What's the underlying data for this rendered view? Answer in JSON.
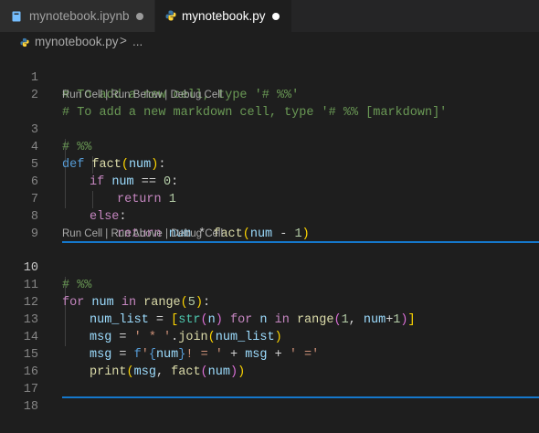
{
  "tabs": [
    {
      "title": "mynotebook.ipynb",
      "modified": true
    },
    {
      "title": "mynotebook.py",
      "modified": true
    }
  ],
  "breadcrumb": {
    "file": "mynotebook.py",
    "separator": ">",
    "more": "..."
  },
  "codelens": {
    "first": "Run Cell | Run Below | Debug Cell",
    "second": "Run Cell | Run Above | Debug Cell"
  },
  "line_numbers": [
    "1",
    "2",
    "3",
    "4",
    "5",
    "6",
    "7",
    "8",
    "9",
    "10",
    "11",
    "12",
    "13",
    "14",
    "15",
    "16",
    "17",
    "18"
  ],
  "active_line": "10",
  "code": {
    "l1": "# To add a new cell, type '# %%'",
    "l2": "# To add a new markdown cell, type '# %% [markdown]'",
    "l3": "# %%",
    "l4_kw": "def",
    "l4_fn": "fact",
    "l4_open": "(",
    "l4_param": "num",
    "l4_close": ")",
    "l4_colon": ":",
    "l5_kw": "if",
    "l5_var": "num",
    "l5_op": " == ",
    "l5_num": "0",
    "l5_colon": ":",
    "l6_kw": "return",
    "l6_num": "1",
    "l7_kw": "else",
    "l7_colon": ":",
    "l8_kw": "return",
    "l8_var": "num",
    "l8_op": " * ",
    "l8_fn": "fact",
    "l8_open": "(",
    "l8_var2": "num",
    "l8_op2": " - ",
    "l8_num": "1",
    "l8_close": ")",
    "l10": "# %%",
    "l11_kw": "for",
    "l11_var": "num",
    "l11_in": "in",
    "l11_fn": "range",
    "l11_open": "(",
    "l11_num": "5",
    "l11_close": ")",
    "l11_colon": ":",
    "l12_var": "num_list",
    "l12_eq": " = ",
    "l12_b1": "[",
    "l12_cls": "str",
    "l12_p1": "(",
    "l12_n": "n",
    "l12_p1c": ")",
    "l12_for": "for",
    "l12_n2": "n",
    "l12_in": "in",
    "l12_range": "range",
    "l12_p2": "(",
    "l12_one": "1",
    "l12_comma": ", ",
    "l12_num": "num",
    "l12_plus": "+",
    "l12_one2": "1",
    "l12_p2c": ")",
    "l12_b1c": "]",
    "l13_var": "msg",
    "l13_eq": " = ",
    "l13_str": "' * '",
    "l13_dot": ".",
    "l13_fn": "join",
    "l13_p": "(",
    "l13_arg": "num_list",
    "l13_pc": ")",
    "l14_var": "msg",
    "l14_eq": " = ",
    "l14_f": "f",
    "l14_s1": "'",
    "l14_brace": "{",
    "l14_num": "num",
    "l14_bracec": "}",
    "l14_s2": "! = '",
    "l14_plus": " + ",
    "l14_msg": "msg",
    "l14_plus2": " + ",
    "l14_s3": "' ='",
    "l15_fn": "print",
    "l15_p": "(",
    "l15_msg": "msg",
    "l15_comma": ", ",
    "l15_fact": "fact",
    "l15_p2": "(",
    "l15_num": "num",
    "l15_p2c": ")",
    "l15_pc": ")"
  },
  "colors": {
    "accent": "#1578cc",
    "background": "#1e1e1e",
    "tabbar": "#252526"
  }
}
